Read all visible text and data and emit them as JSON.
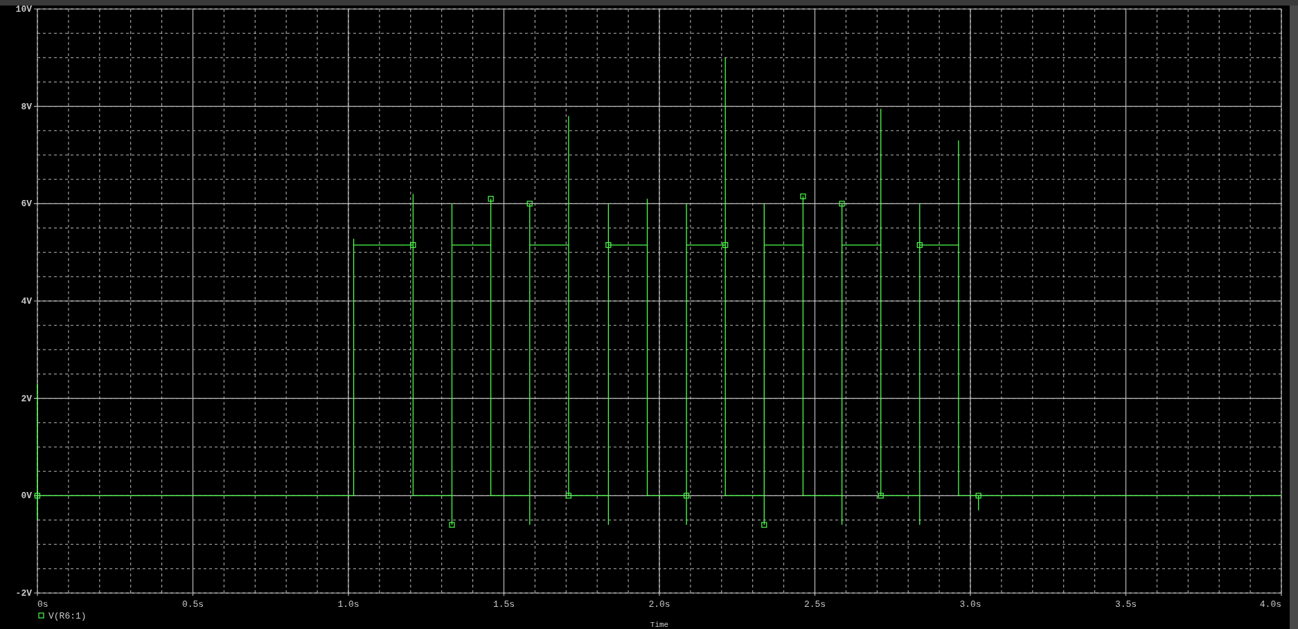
{
  "probe_window": {
    "chart_data": {
      "type": "line",
      "grid": true,
      "xlabel": "Time",
      "xlim": [
        0,
        4
      ],
      "ylim": [
        -2,
        10
      ],
      "xticks": [
        {
          "value": 0,
          "label": "0s"
        },
        {
          "value": 0.5,
          "label": "0.5s"
        },
        {
          "value": 1,
          "label": "1.0s"
        },
        {
          "value": 1.5,
          "label": "1.5s"
        },
        {
          "value": 2,
          "label": "2.0s"
        },
        {
          "value": 2.5,
          "label": "2.5s"
        },
        {
          "value": 3,
          "label": "3.0s"
        },
        {
          "value": 3.5,
          "label": "3.5s"
        },
        {
          "value": 4,
          "label": "4.0s"
        }
      ],
      "yticks": [
        {
          "value": -2,
          "label": "-2V"
        },
        {
          "value": 0,
          "label": "0V"
        },
        {
          "value": 2,
          "label": "2V"
        },
        {
          "value": 4,
          "label": "4V"
        },
        {
          "value": 6,
          "label": "6V"
        },
        {
          "value": 8,
          "label": "8V"
        },
        {
          "value": 10,
          "label": "10V"
        }
      ],
      "x": [
        0,
        0,
        0,
        1.017,
        1.017,
        1.017,
        1.208,
        1.208,
        1.208,
        1.333,
        1.333,
        1.333,
        1.333,
        1.458,
        1.458,
        1.458,
        1.583,
        1.583,
        1.583,
        1.583,
        1.708,
        1.708,
        1.708,
        1.836,
        1.836,
        1.836,
        1.836,
        1.961,
        1.961,
        1.961,
        2.087,
        2.087,
        2.087,
        2.087,
        2.212,
        2.212,
        2.212,
        2.337,
        2.337,
        2.337,
        2.337,
        2.462,
        2.462,
        2.462,
        2.587,
        2.587,
        2.587,
        2.587,
        2.712,
        2.712,
        2.712,
        2.837,
        2.837,
        2.837,
        2.837,
        2.962,
        2.962,
        2.962,
        3.026,
        3.026,
        3.026,
        4
      ],
      "series": [
        {
          "name": "V(R6:1)",
          "color": "#4cff4c",
          "values": [
            2.3,
            -0.5,
            0,
            0,
            5.28,
            5.15,
            5.15,
            6.2,
            0,
            0,
            -0.6,
            6.0,
            5.15,
            5.15,
            6.1,
            0,
            0,
            -0.6,
            6.0,
            5.15,
            5.15,
            7.8,
            0,
            0,
            -0.6,
            6.0,
            5.15,
            5.15,
            6.1,
            0,
            0,
            -0.6,
            6.0,
            5.15,
            5.15,
            9.0,
            0,
            0,
            -0.6,
            6.0,
            5.15,
            5.15,
            6.15,
            0,
            0,
            -0.6,
            6.0,
            5.15,
            5.15,
            7.95,
            0,
            0,
            -0.6,
            6.0,
            5.15,
            5.15,
            7.3,
            0,
            0,
            -0.3,
            0,
            0
          ]
        }
      ]
    }
  }
}
